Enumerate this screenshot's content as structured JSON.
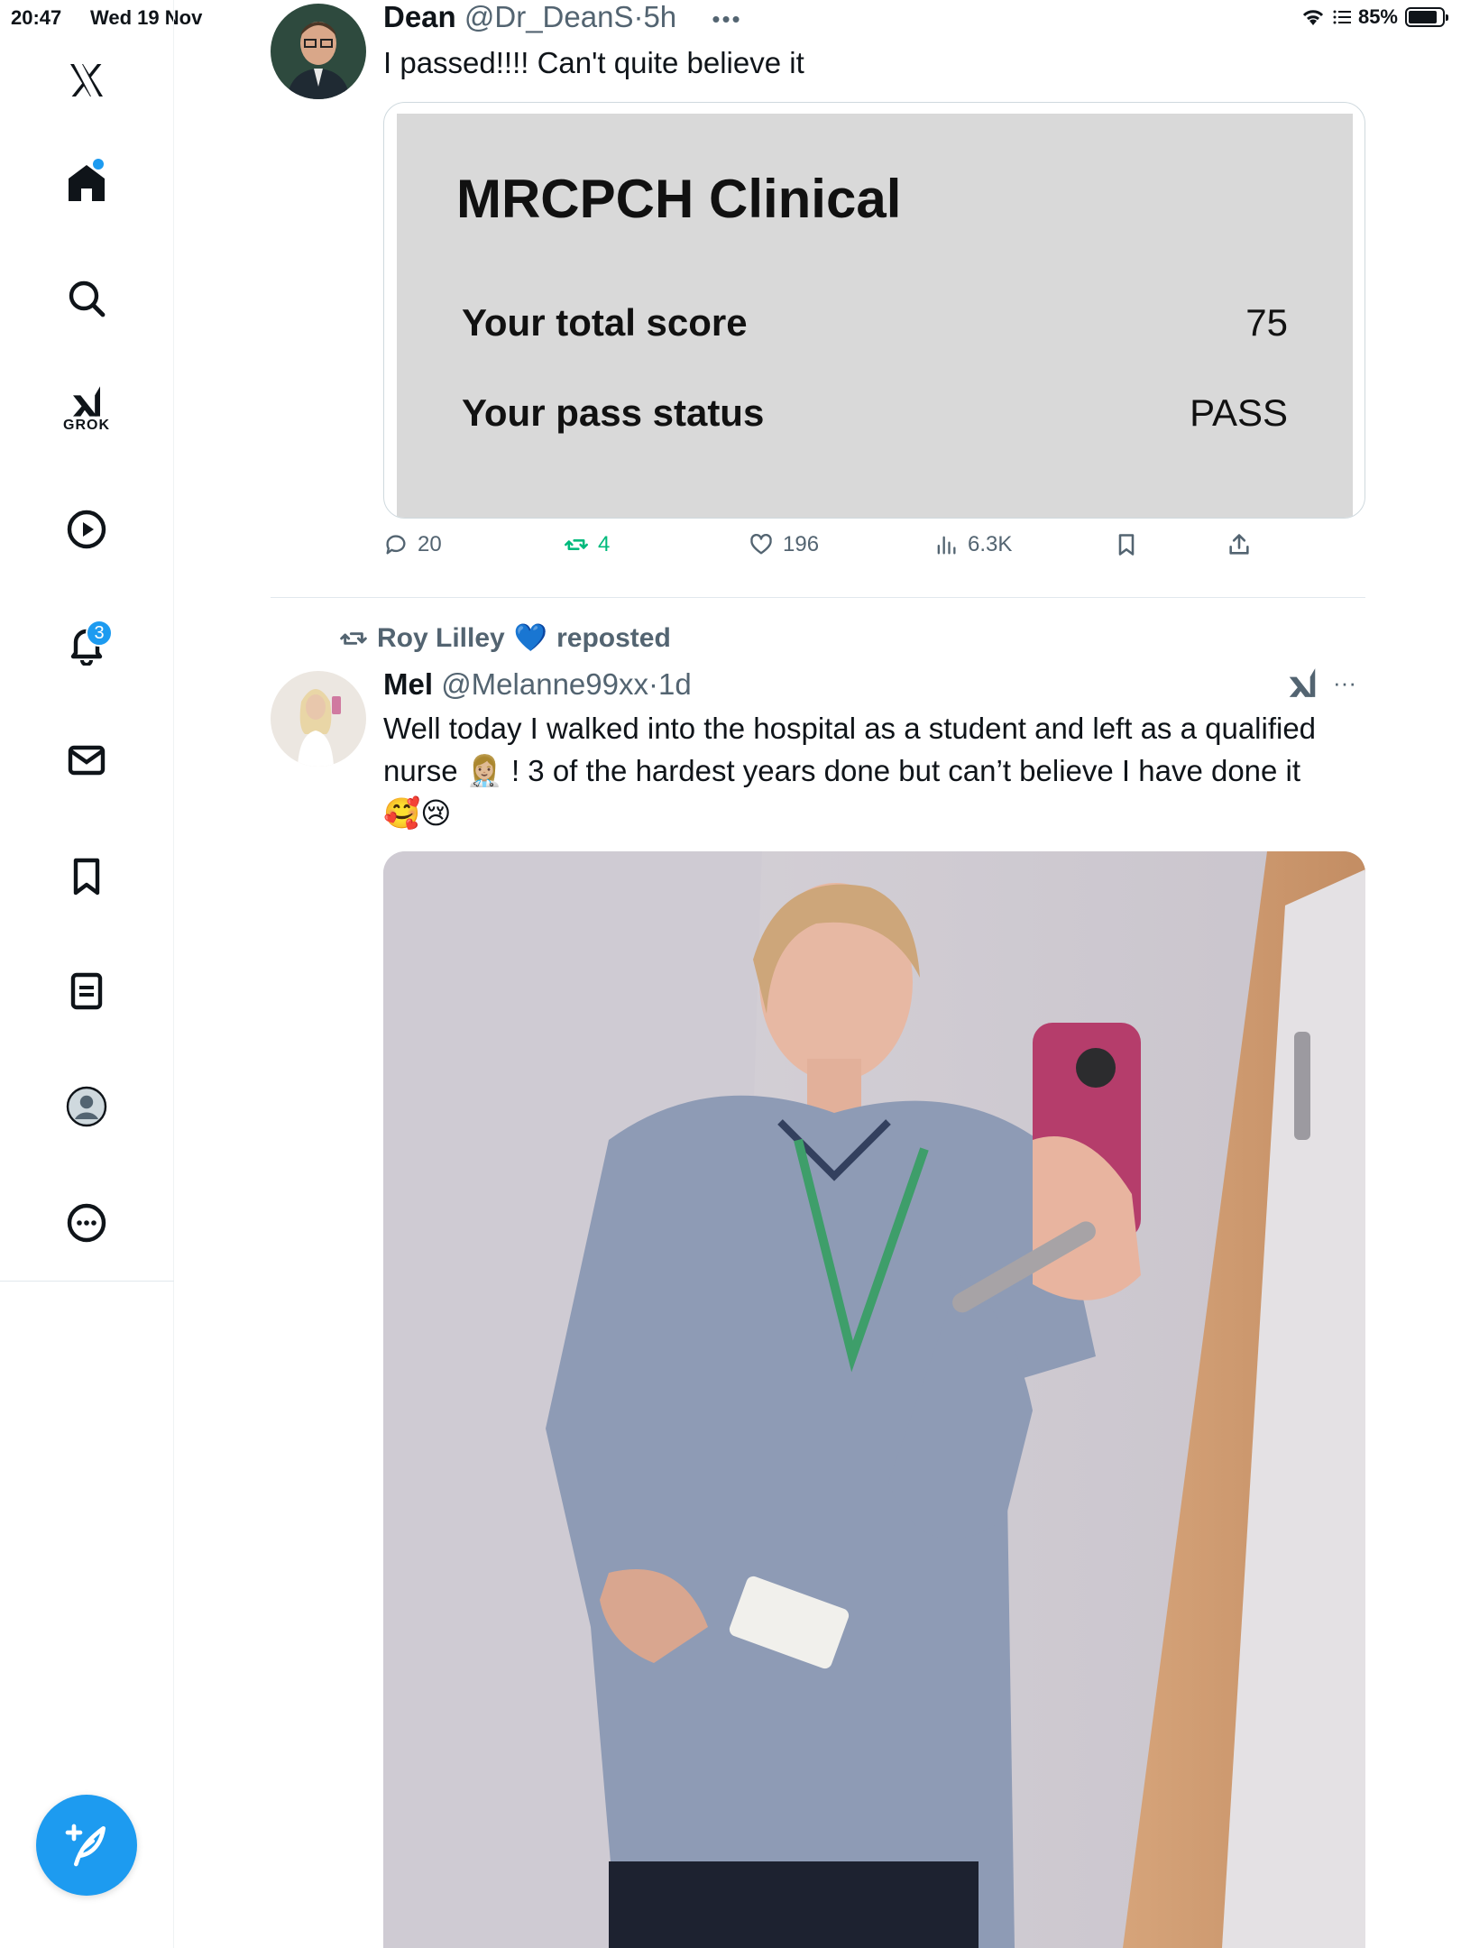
{
  "status_bar": {
    "time": "20:47",
    "date": "Wed 19 Nov",
    "battery": "85%",
    "battery_level": 0.85
  },
  "sidebar": {
    "items": [
      {
        "name": "home",
        "icon": "home-icon"
      },
      {
        "name": "explore",
        "icon": "search-icon"
      },
      {
        "name": "grok",
        "icon": "grok-icon",
        "label": "GROK"
      },
      {
        "name": "videos",
        "icon": "play-icon"
      },
      {
        "name": "notifications",
        "icon": "bell-icon",
        "badge": "3"
      },
      {
        "name": "messages",
        "icon": "mail-icon"
      },
      {
        "name": "bookmarks",
        "icon": "bookmark-icon"
      },
      {
        "name": "lists",
        "icon": "list-icon"
      },
      {
        "name": "profile",
        "icon": "profile-icon"
      },
      {
        "name": "more",
        "icon": "more-icon"
      }
    ],
    "compose_icon": "compose-icon"
  },
  "tweet1": {
    "name": "Dean",
    "handle": "@Dr_DeanS",
    "sep": "·",
    "time": "5h",
    "more": "•••",
    "text": "I passed!!!! Can't quite believe it",
    "card": {
      "title": "MRCPCH Clinical",
      "score_label": "Your total score",
      "score_value": "75",
      "status_label": "Your pass status",
      "status_value": "PASS"
    },
    "actions": {
      "replies": "20",
      "reposts": "4",
      "likes": "196",
      "views": "6.3K"
    }
  },
  "tweet2": {
    "repost_by": "Roy Lilley",
    "repost_emoji": "💙",
    "repost_word": "reposted",
    "name": "Mel",
    "handle": "@Melanne99xx",
    "sep": "·",
    "time": "1d",
    "more": "···",
    "text_line1": "Well today I walked into the hospital as a student and left as a qualified",
    "text_line2": "nurse 👩🏼‍⚕️ ! 3 of the hardest years done but can’t believe I have done it",
    "text_line3": "🥰😢"
  },
  "colors": {
    "accent": "#1d9bf0",
    "repost_green": "#00ba7c",
    "muted": "#536471",
    "text": "#0f1419"
  }
}
